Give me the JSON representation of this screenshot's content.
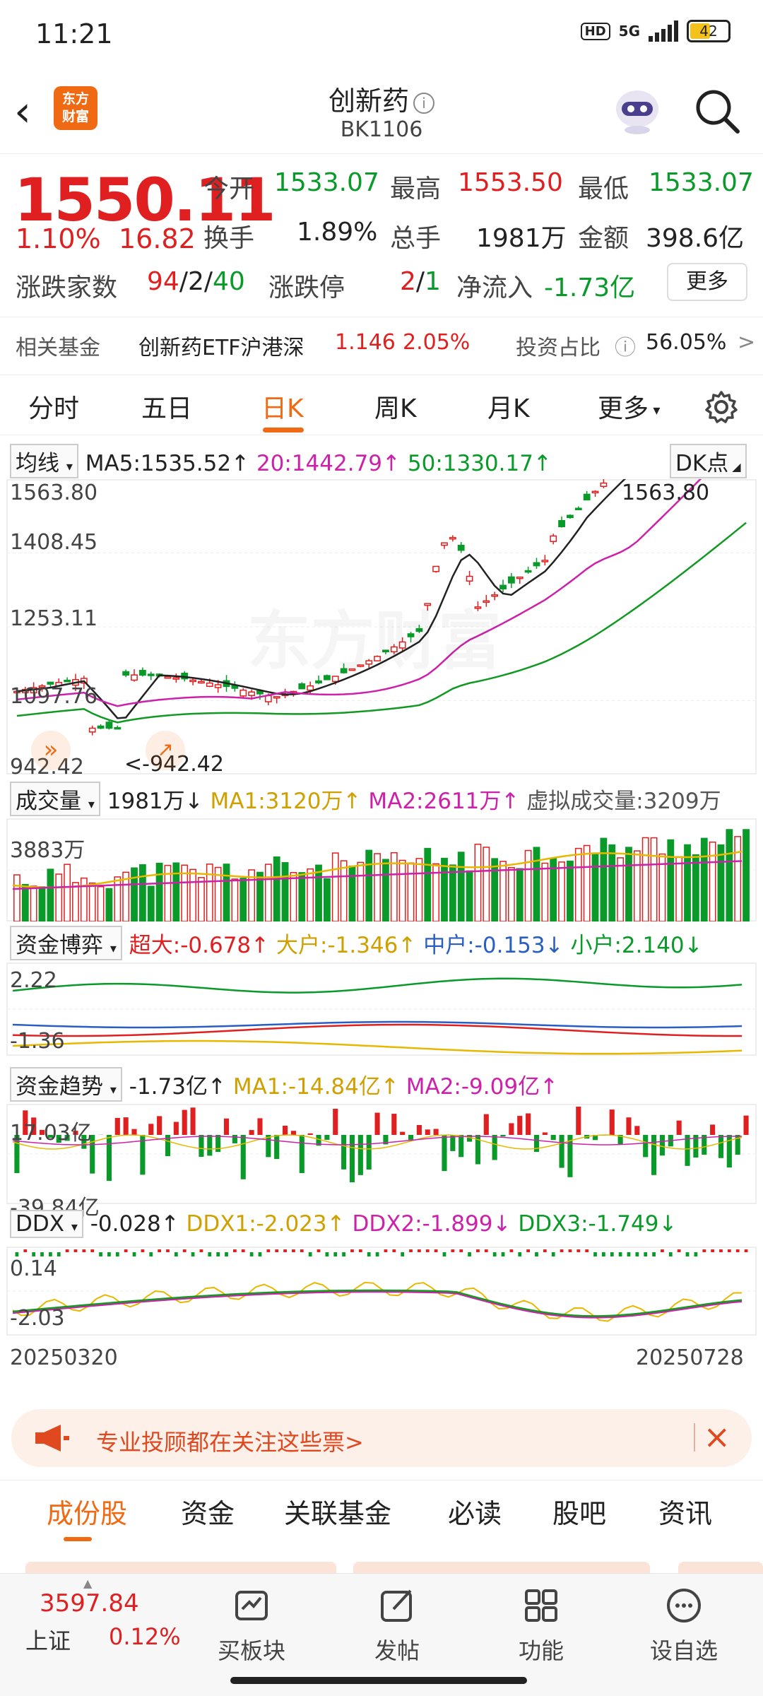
{
  "status": {
    "time": "11:21",
    "hd": "HD",
    "network": "5G",
    "battery": "42"
  },
  "header": {
    "title": "创新药",
    "code": "BK1106",
    "logo_line1": "东方",
    "logo_line2": "财富"
  },
  "quote": {
    "price": "1550.11",
    "change_pct": "1.10%",
    "change": "16.82",
    "open_label": "今开",
    "open": "1533.07",
    "high_label": "最高",
    "high": "1553.50",
    "low_label": "最低",
    "low": "1533.07",
    "turnover_label": "换手",
    "turnover": "1.89%",
    "volume_label": "总手",
    "volume": "1981万",
    "amount_label": "金额",
    "amount": "398.6亿",
    "updown_label": "涨跌家数",
    "up": "94",
    "flat": "2",
    "down": "40",
    "limit_label": "涨跌停",
    "limit_up": "2",
    "limit_down": "1",
    "netflow_label": "净流入",
    "netflow": "-1.73亿",
    "more_button": "更多"
  },
  "related_fund": {
    "label": "相关基金",
    "name": "创新药ETF沪港深",
    "price": "1.146",
    "pct": "2.05%",
    "ratio_label": "投资占比",
    "ratio": "56.05%"
  },
  "period_tabs": [
    "分时",
    "五日",
    "日K",
    "周K",
    "月K",
    "更多"
  ],
  "active_period": "日K",
  "kline": {
    "selector": "均线",
    "ma5": "MA5:1535.52",
    "ma20": "20:1442.79",
    "ma50": "50:1330.17",
    "dk_button": "DK点",
    "y_labels": [
      "1563.80",
      "1408.45",
      "1253.11",
      "1097.76",
      "942.42"
    ],
    "high_marker": "1563.80",
    "low_marker": "<-942.42",
    "watermark": "东方财富"
  },
  "volume": {
    "selector": "成交量",
    "value": "1981万",
    "ma1": "MA1:3120万",
    "ma2": "MA2:2611万",
    "virtual": "虚拟成交量:3209万",
    "y_label": "3883万"
  },
  "fund_game": {
    "selector": "资金博弈",
    "super": "超大:-0.678",
    "large": "大户:-1.346",
    "medium": "中户:-0.153",
    "small": "小户:2.140",
    "y_top": "2.22",
    "y_bottom": "-1.36"
  },
  "fund_trend": {
    "selector": "资金趋势",
    "value": "-1.73亿",
    "ma1": "MA1:-14.84亿",
    "ma2": "MA2:-9.09亿",
    "y_top": "17.03亿",
    "y_bottom": "-39.84亿"
  },
  "ddx": {
    "selector": "DDX",
    "value": "-0.028",
    "ddx1": "DDX1:-2.023",
    "ddx2": "DDX2:-1.899",
    "ddx3": "DDX3:-1.749",
    "y_top": "0.14",
    "y_bottom": "-2.03"
  },
  "date_range": {
    "start": "20250320",
    "end": "20250728"
  },
  "ad": {
    "text": "专业投顾都在关注这些票>"
  },
  "sub_tabs": [
    "成份股",
    "资金",
    "关联基金",
    "必读",
    "股吧",
    "资讯"
  ],
  "active_sub_tab": "成份股",
  "bottom": {
    "index_value": "3597.84",
    "index_name": "上证",
    "index_pct": "0.12%",
    "nav": [
      "买板块",
      "发帖",
      "功能",
      "设自选"
    ]
  }
}
